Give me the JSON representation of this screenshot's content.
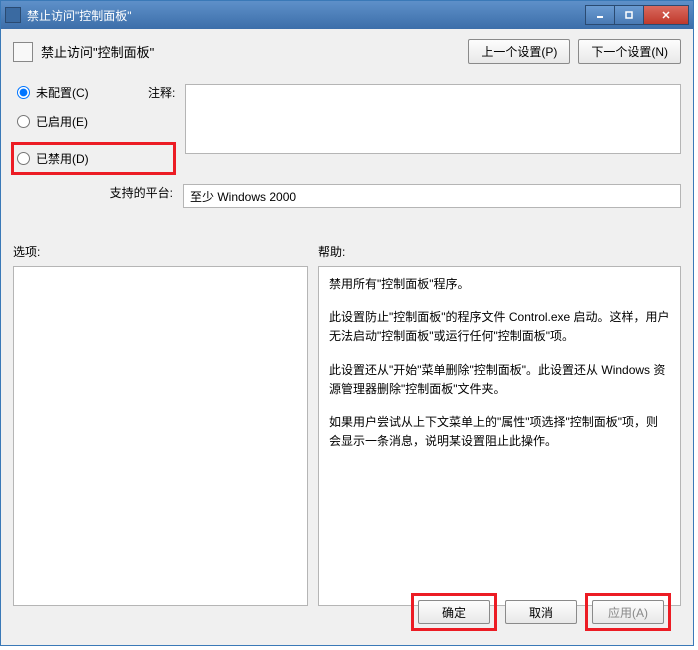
{
  "titlebar": {
    "title": "禁止访问\"控制面板\""
  },
  "header": {
    "title": "禁止访问\"控制面板\"",
    "prev_btn": "上一个设置(P)",
    "next_btn": "下一个设置(N)"
  },
  "radios": {
    "not_configured": "未配置(C)",
    "enabled": "已启用(E)",
    "disabled": "已禁用(D)"
  },
  "labels": {
    "comment": "注释:",
    "platform": "支持的平台:",
    "options": "选项:",
    "help": "帮助:"
  },
  "platform_text": "至少 Windows 2000",
  "help_text": {
    "p1": "禁用所有\"控制面板\"程序。",
    "p2": "此设置防止\"控制面板\"的程序文件 Control.exe 启动。这样，用户无法启动\"控制面板\"或运行任何\"控制面板\"项。",
    "p3": "此设置还从\"开始\"菜单删除\"控制面板\"。此设置还从 Windows 资源管理器删除\"控制面板\"文件夹。",
    "p4": "如果用户尝试从上下文菜单上的\"属性\"项选择\"控制面板\"项，则会显示一条消息，说明某设置阻止此操作。"
  },
  "footer": {
    "ok": "确定",
    "cancel": "取消",
    "apply": "应用(A)"
  }
}
